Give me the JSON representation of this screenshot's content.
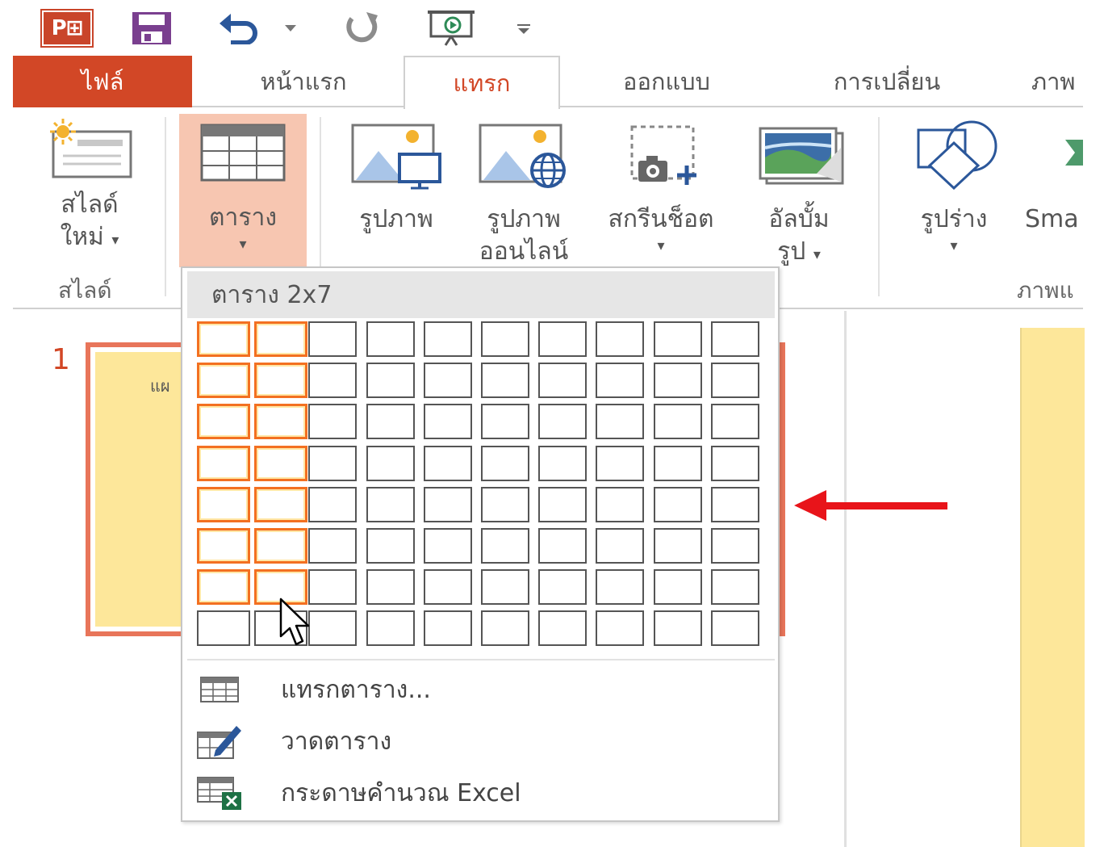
{
  "qat": {
    "logo_text": "P⊞",
    "icons": [
      "powerpoint-logo-icon",
      "save-icon",
      "undo-icon",
      "chevron-down-icon",
      "redo-icon",
      "presentation-icon",
      "customize-qat-icon"
    ]
  },
  "tabs": {
    "file": "ไฟล์",
    "home": "หน้าแรก",
    "insert": "แทรก",
    "design": "ออกแบบ",
    "transitions": "การเปลี่ยน",
    "animations": "ภาพ"
  },
  "ribbon": {
    "new_slide_line1": "สไลด์",
    "new_slide_line2": "ใหม่",
    "slides_group": "สไลด์",
    "table": "ตาราง",
    "pictures": "รูปภาพ",
    "online_pictures_line1": "รูปภาพ",
    "online_pictures_line2": "ออนไลน์",
    "screenshot": "สกรีนช็อต",
    "album_line1": "อัลบั้ม",
    "album_line2": "รูป",
    "shapes": "รูปร่าง",
    "smartart": "Sma",
    "illustrations_group": "ภาพแ",
    "dropdown_arrow": "▾"
  },
  "slide_panel": {
    "slide_number": "1",
    "thumb_text": "แผ"
  },
  "dropdown": {
    "header": "ตาราง 2x7",
    "grid": {
      "cols": 10,
      "rows": 8,
      "selected_cols": 2,
      "selected_rows": 7
    },
    "insert_table": "แทรกตาราง...",
    "draw_table": "วาดตาราง",
    "excel_sheet": "กระดาษคำนวณ Excel"
  },
  "colors": {
    "accent": "#d24726",
    "selected_cell": "#f37021",
    "arrow": "#e8141a",
    "slide_bg": "#fde79a"
  }
}
